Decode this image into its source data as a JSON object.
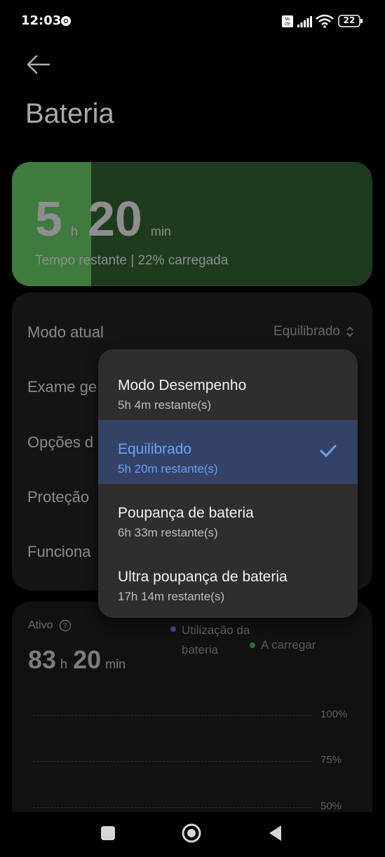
{
  "status_bar": {
    "time": "12:03",
    "battery_level": "22",
    "icons": [
      "chrome-icon",
      "volte-icon",
      "signal-icon",
      "wifi-icon",
      "battery-icon"
    ]
  },
  "header": {
    "back_icon": "back-arrow-icon",
    "title": "Bateria"
  },
  "battery_card": {
    "hours": "5",
    "hours_unit": "h",
    "minutes": "20",
    "minutes_unit": "min",
    "subtitle": "Tempo restante | 22% carregada",
    "charge_level": 0.22,
    "fill_color": "#3f7a3f",
    "bg_color": "#1f3b1f"
  },
  "settings": {
    "current_mode_label": "Modo atual",
    "current_mode_value": "Equilibrado",
    "rows_visible": [
      "Exame ge",
      "Opções d",
      "Proteção",
      "Funciona"
    ]
  },
  "mode_dropdown": {
    "items": [
      {
        "title": "Modo Desempenho",
        "subtitle": "5h 4m restante(s)",
        "selected": false
      },
      {
        "title": "Equilibrado",
        "subtitle": "5h 20m restante(s)",
        "selected": true
      },
      {
        "title": "Poupança de bateria",
        "subtitle": "6h 33m restante(s)",
        "selected": false
      },
      {
        "title": "Ultra poupança de bateria",
        "subtitle": "17h 14m restante(s)",
        "selected": false
      }
    ],
    "selected_color": "#6ea1f5",
    "selected_bg": "#334266"
  },
  "usage": {
    "active_label": "Ativo",
    "active_hours": "83",
    "active_hours_unit": "h",
    "active_minutes": "20",
    "active_minutes_unit": "min",
    "legend_usage": "Utilização da bateria",
    "legend_usage_color": "#3a4a8a",
    "legend_charge": "A carregar",
    "legend_charge_color": "#2f6a35",
    "ticks": [
      "100%",
      "75%",
      "50%"
    ]
  },
  "nav_bar": {
    "icons": [
      "recents-square-icon",
      "home-circle-icon",
      "back-triangle-icon"
    ]
  }
}
